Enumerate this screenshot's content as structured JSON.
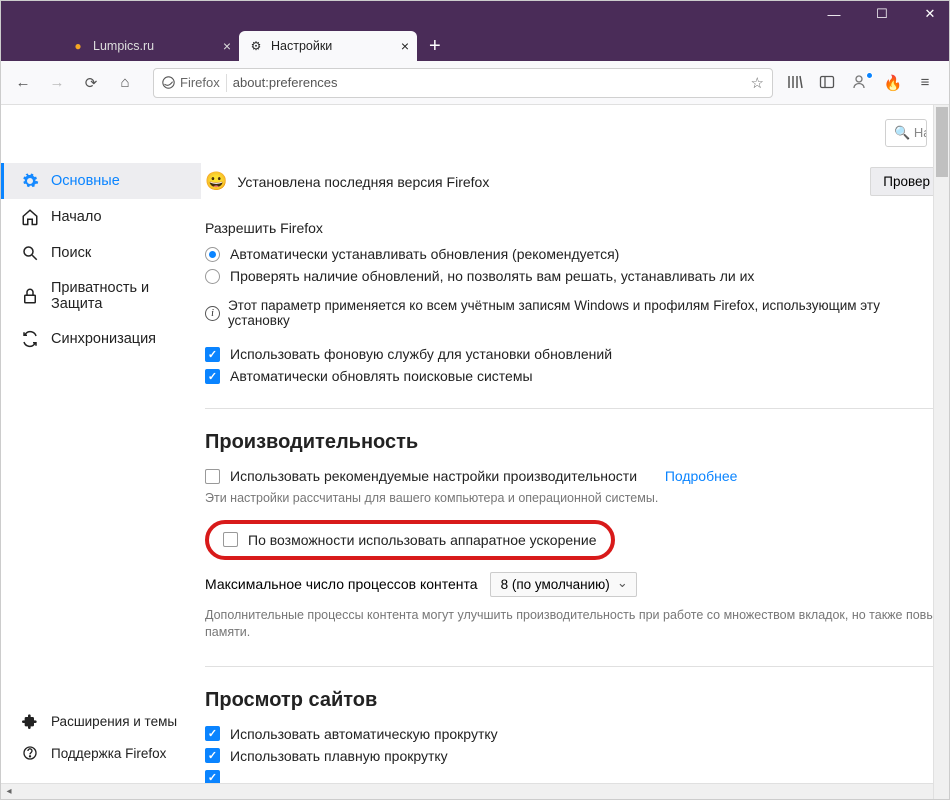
{
  "window": {
    "min": "—",
    "max": "☐",
    "close": "✕"
  },
  "tabs": {
    "tab1": "Lumpics.ru",
    "tab2": "Настройки",
    "plus": "+"
  },
  "urlbar": {
    "identity": "Firefox",
    "url": "about:preferences"
  },
  "searchbox": {
    "placeholder": "Най"
  },
  "sidebar": {
    "general": "Основные",
    "home": "Начало",
    "search": "Поиск",
    "privacy": "Приватность и Защита",
    "sync": "Синхронизация",
    "addons": "Расширения и темы",
    "support": "Поддержка Firefox"
  },
  "updates": {
    "version_line": "Установлена последняя версия Firefox",
    "check_btn": "Провер",
    "allow_label": "Разрешить Firefox",
    "radio_auto": "Автоматически устанавливать обновления (рекомендуется)",
    "radio_check": "Проверять наличие обновлений, но позволять вам решать, устанавливать ли их",
    "info": "Этот параметр применяется ко всем учётным записям Windows и профилям Firefox, использующим эту установку",
    "bg_service": "Использовать фоновую службу для установки обновлений",
    "auto_search": "Автоматически обновлять поисковые системы"
  },
  "performance": {
    "title": "Производительность",
    "recommended": "Использовать рекомендуемые настройки производительности",
    "learn_more": "Подробнее",
    "note1": "Эти настройки рассчитаны для вашего компьютера и операционной системы.",
    "hw_accel": "По возможности использовать аппаратное ускорение",
    "proc_label": "Максимальное число процессов контента",
    "proc_value": "8 (по умолчанию)",
    "note2": "Дополнительные процессы контента могут улучшить производительность при работе со множеством вкладок, но также повы памяти."
  },
  "browsing": {
    "title": "Просмотр сайтов",
    "autoscroll": "Использовать автоматическую прокрутку",
    "smooth": "Использовать плавную прокрутку"
  }
}
